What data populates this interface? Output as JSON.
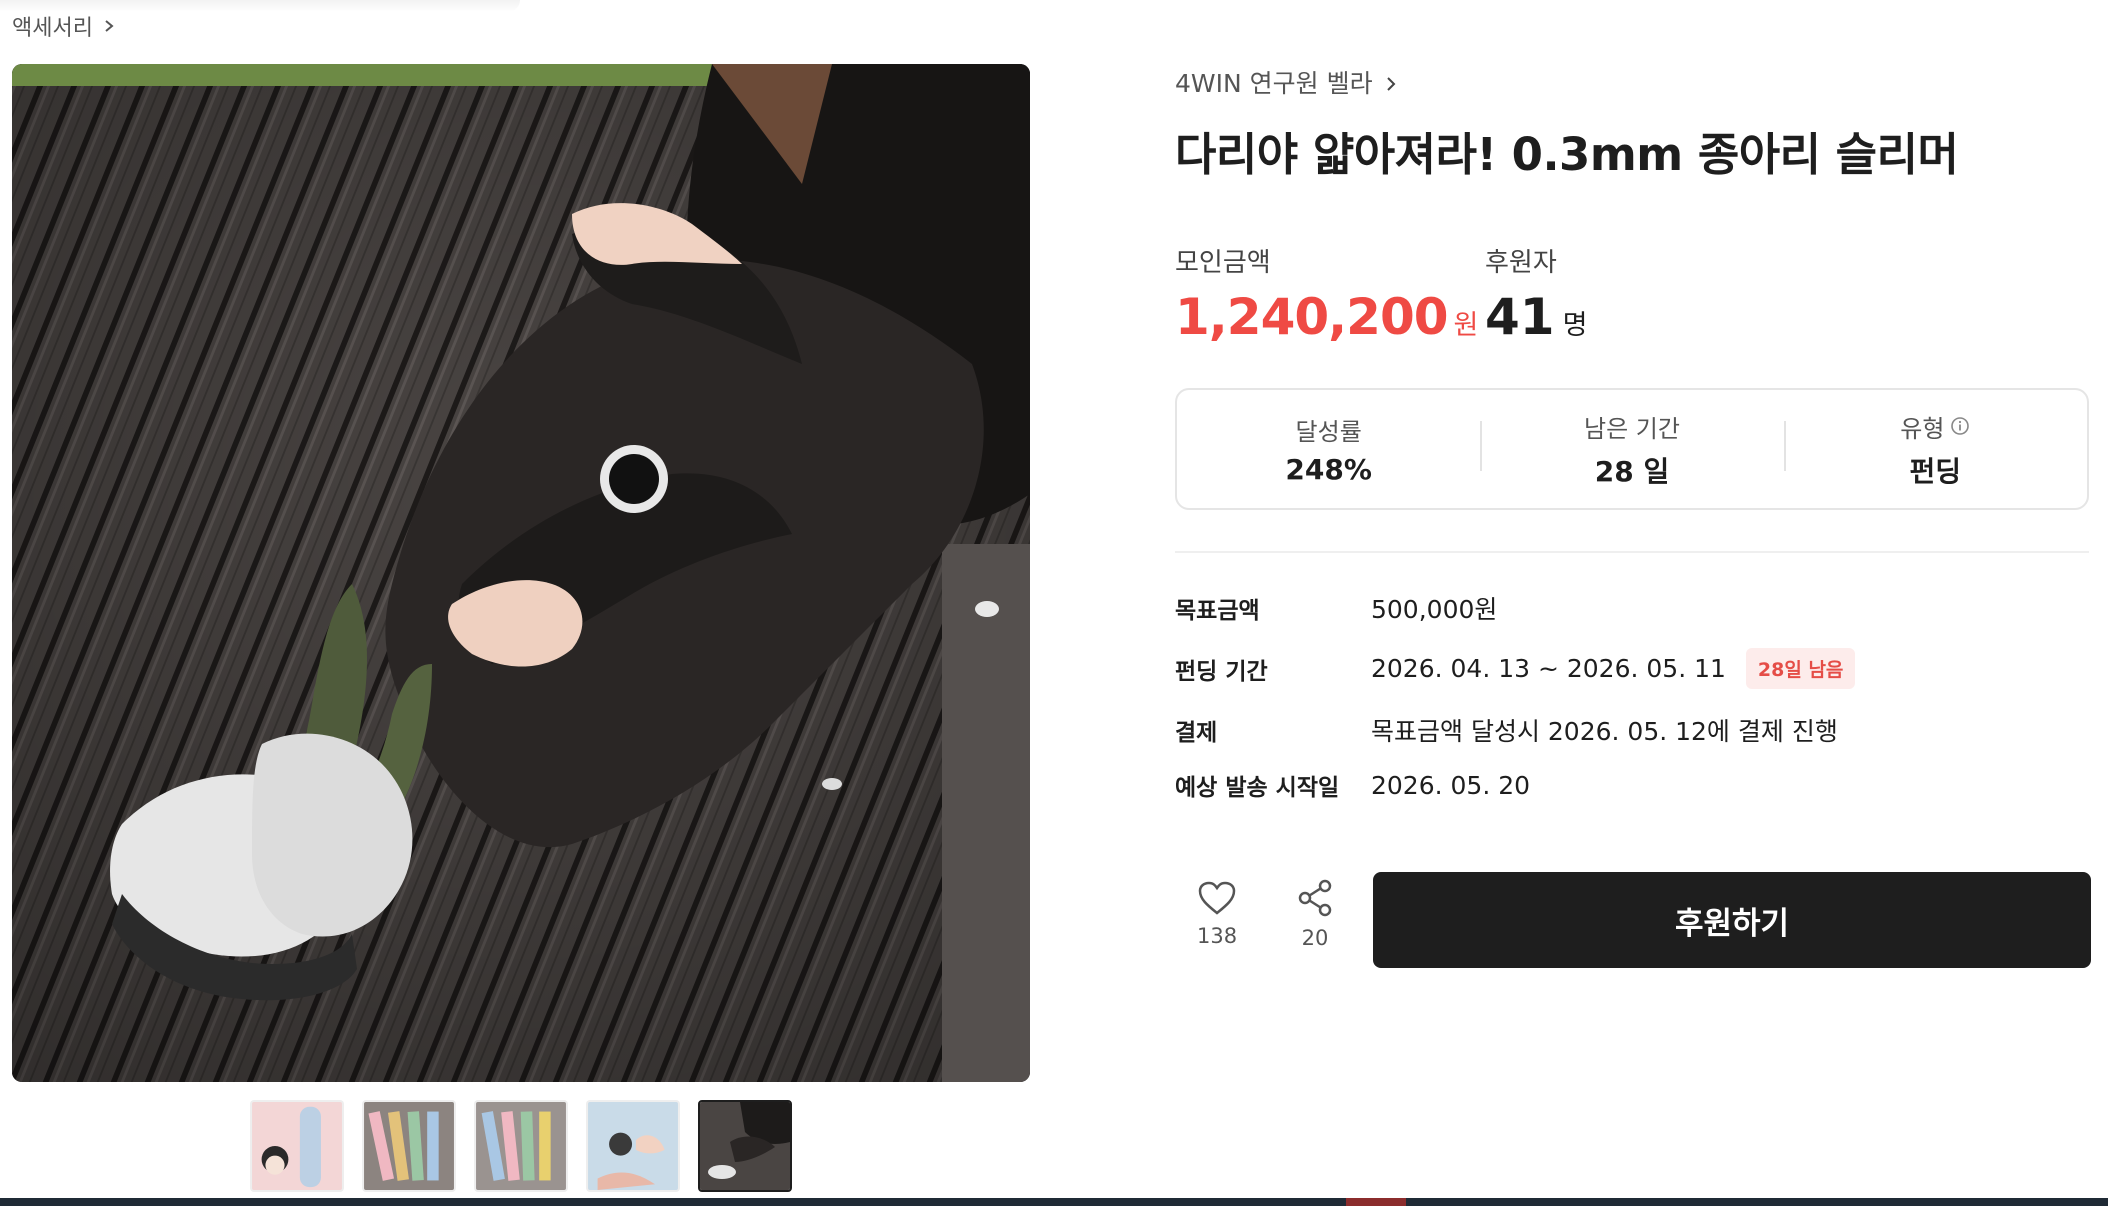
{
  "breadcrumb": {
    "label": "액세서리"
  },
  "project": {
    "creator": "4WIN 연구원 벨라",
    "title": "다리야 얇아져라! 0.3mm 종아리 슬리머"
  },
  "stats": {
    "raised_label": "모인금액",
    "raised_value": "1,240,200",
    "raised_unit": "원",
    "supporters_label": "후원자",
    "supporters_value": "41",
    "supporters_unit": "명"
  },
  "info_box": {
    "achievement_label": "달성률",
    "achievement_value": "248%",
    "remaining_label": "남은 기간",
    "remaining_value": "28 일",
    "type_label": "유형",
    "type_value": "펀딩"
  },
  "details": {
    "goal_label": "목표금액",
    "goal_value": "500,000원",
    "period_label": "펀딩 기간",
    "period_value": "2026. 04. 13 ~ 2026. 05. 11",
    "period_badge": "28일 남음",
    "payment_label": "결제",
    "payment_value": "목표금액 달성시 2026. 05. 12에 결제 진행",
    "ship_label": "예상 발송 시작일",
    "ship_value": "2026. 05. 20"
  },
  "actions": {
    "like_count": "138",
    "share_count": "20",
    "support_label": "후원하기"
  },
  "colors": {
    "accent_red": "#ef4a44",
    "button_dark": "#1e1e1e",
    "badge_bg": "#fdeceb"
  },
  "icons": [
    "chevron-right-icon",
    "info-icon",
    "heart-icon",
    "share-icon"
  ]
}
